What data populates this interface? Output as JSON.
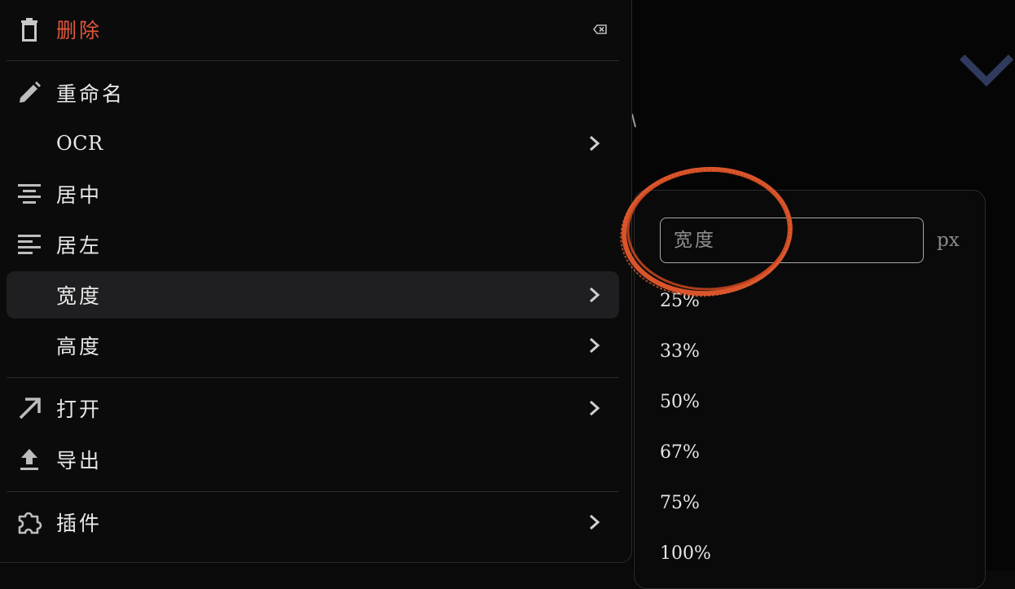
{
  "menu": {
    "items": [
      {
        "label": "删除",
        "icon": "trash-icon",
        "danger": true,
        "shortcut_icon": "backspace-icon"
      },
      {
        "label": "重命名",
        "icon": "pencil-icon"
      },
      {
        "label": "OCR",
        "icon": "",
        "submenu": true
      },
      {
        "label": "居中",
        "icon": "align-center-icon"
      },
      {
        "label": "居左",
        "icon": "align-left-icon"
      },
      {
        "label": "宽度",
        "icon": "",
        "submenu": true,
        "active": true
      },
      {
        "label": "高度",
        "icon": "",
        "submenu": true
      },
      {
        "label": "打开",
        "icon": "arrow-up-right-icon",
        "submenu": true
      },
      {
        "label": "导出",
        "icon": "upload-icon"
      },
      {
        "label": "插件",
        "icon": "puzzle-icon",
        "submenu": true
      }
    ]
  },
  "width_submenu": {
    "input_placeholder": "宽度",
    "unit": "px",
    "options": [
      "25%",
      "33%",
      "50%",
      "67%",
      "75%",
      "100%"
    ]
  },
  "colors": {
    "danger": "#e2573a",
    "annotation": "#d9542b",
    "background": "#0a0a0b",
    "active_item": "#1f1f21",
    "chevron_bg": "#2f3a5c"
  }
}
